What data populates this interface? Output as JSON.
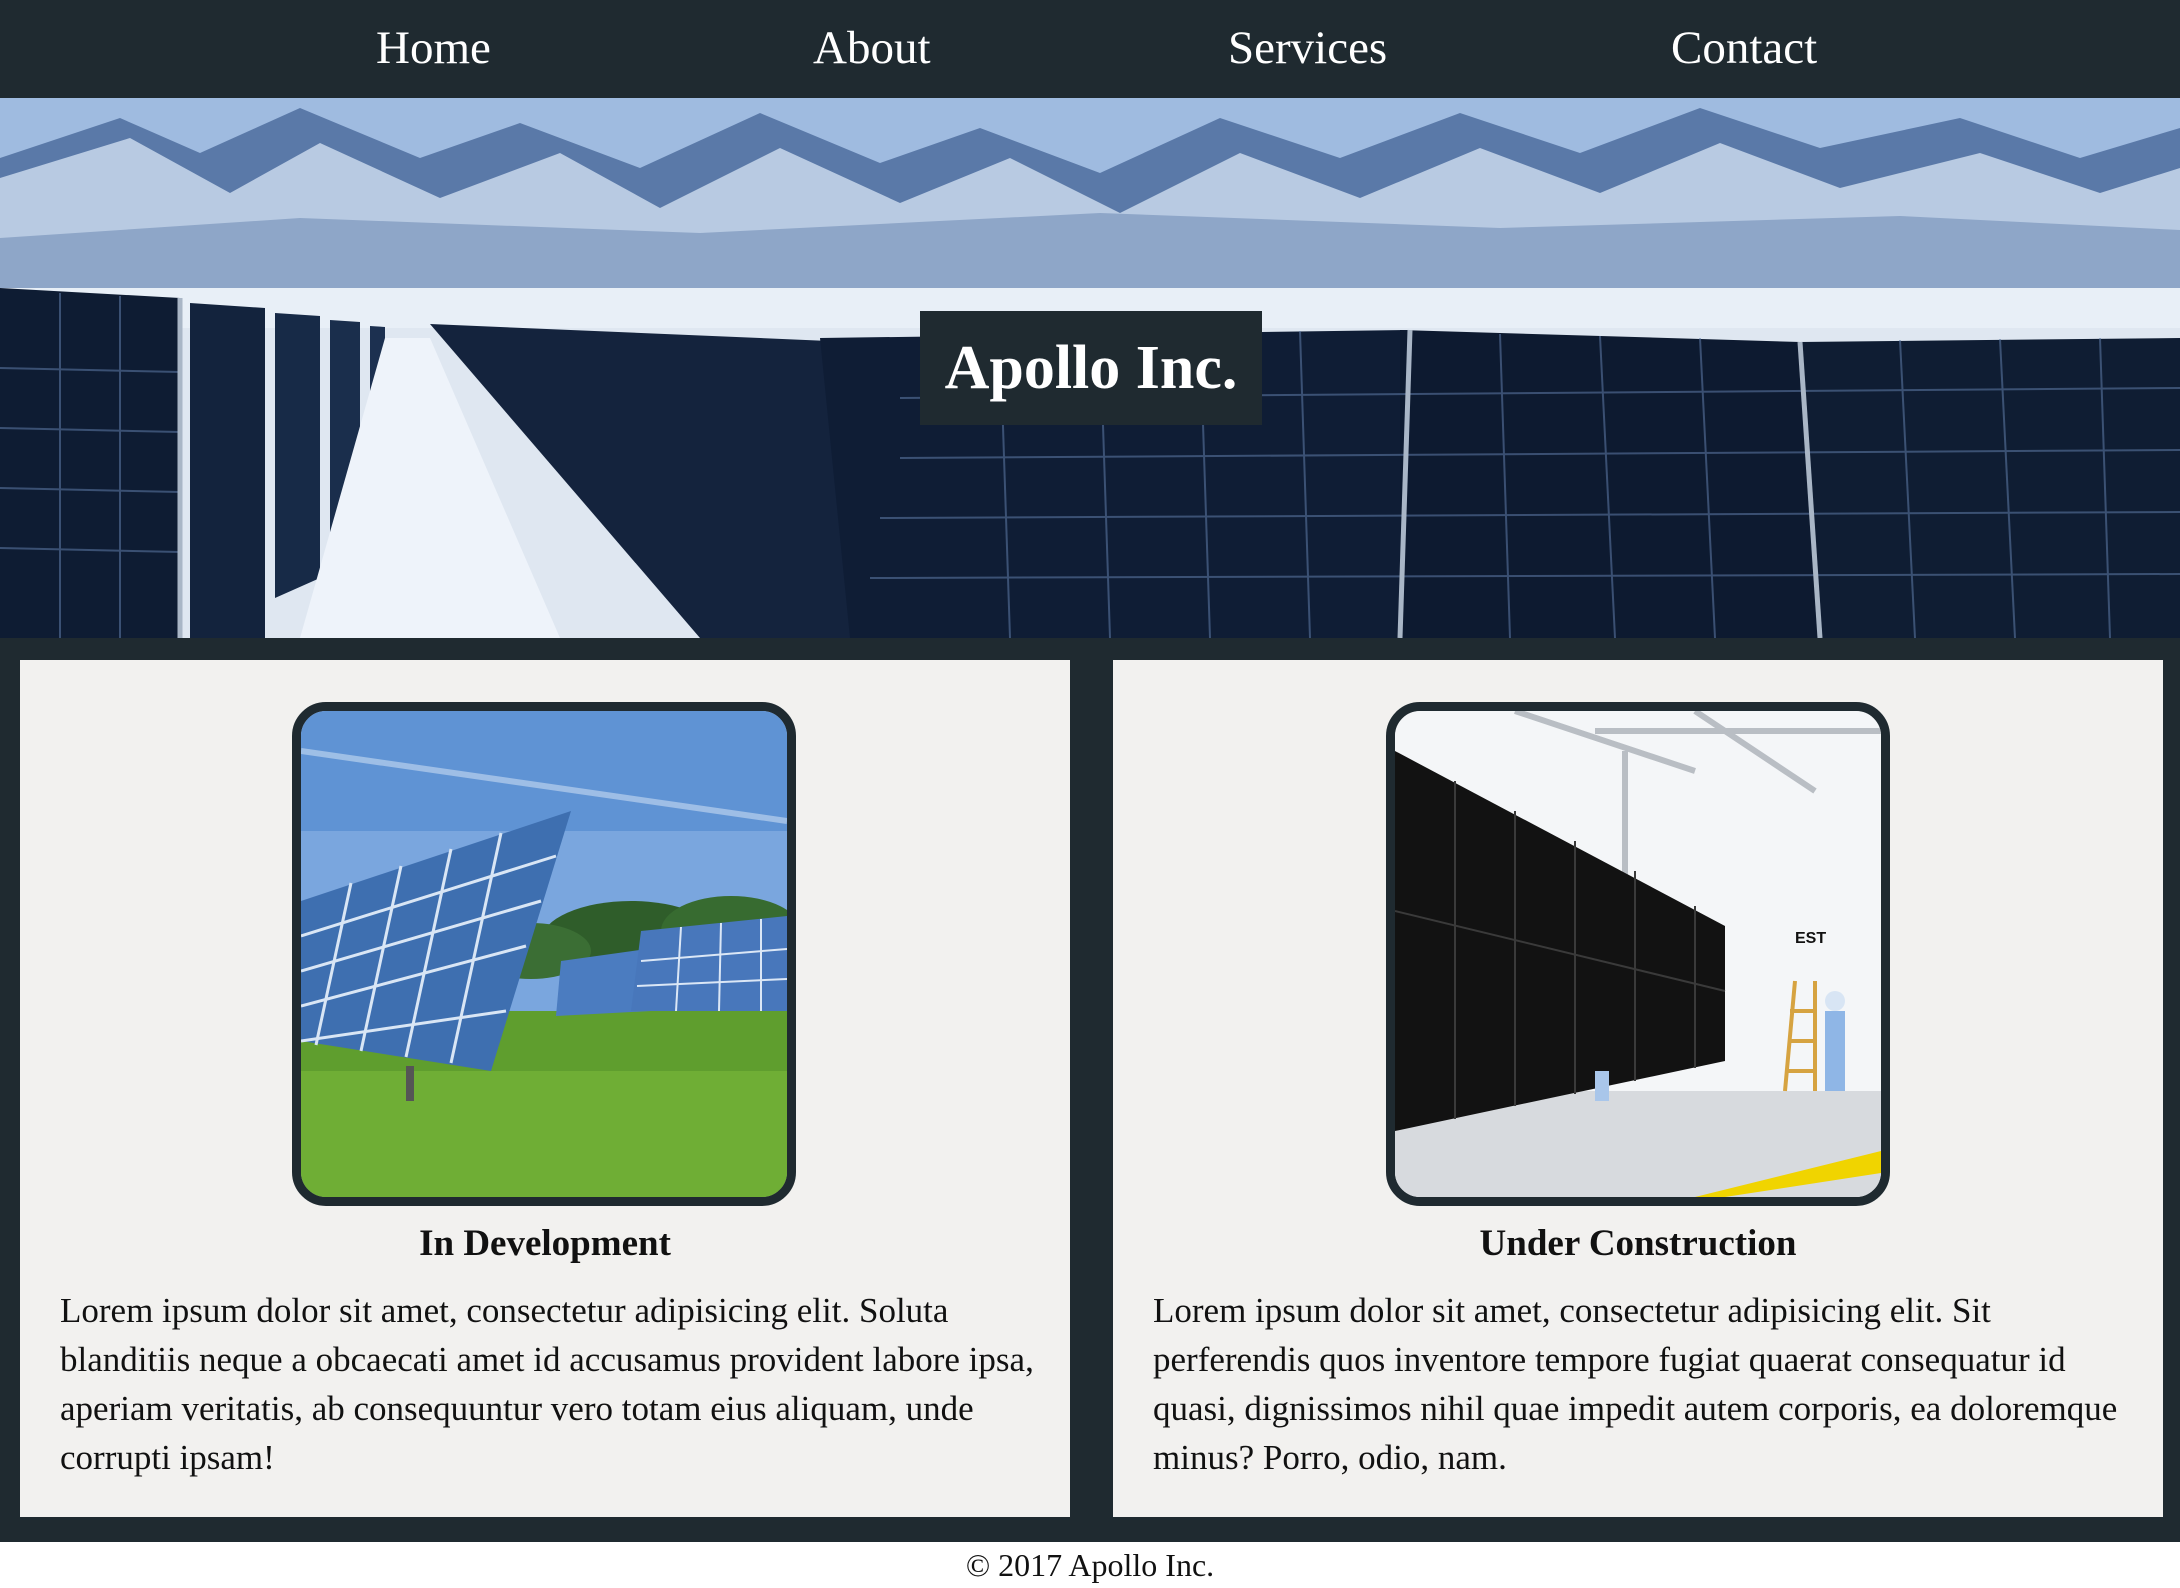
{
  "nav": {
    "items": [
      {
        "label": "Home"
      },
      {
        "label": "About"
      },
      {
        "label": "Services"
      },
      {
        "label": "Contact"
      }
    ]
  },
  "hero": {
    "title": "Apollo Inc."
  },
  "cards": [
    {
      "title": "In Development",
      "text": "Lorem ipsum dolor sit amet, consectetur adipisicing elit. Soluta blanditiis neque a obcaecati amet id accusamus provident labore ipsa, aperiam veritatis, ab consequuntur vero totam eius aliquam, unde corrupti ipsam!"
    },
    {
      "title": "Under Construction",
      "text": "Lorem ipsum dolor sit amet, consectetur adipisicing elit. Sit perferendis quos inventore tempore fugiat quaerat consequatur id quasi, dignissimos nihil quae impedit autem corporis, ea doloremque minus? Porro, odio, nam."
    }
  ],
  "footer": {
    "text": "© 2017 Apollo Inc."
  },
  "colors": {
    "dark": "#1f2a30",
    "card_bg": "#f2f1ef"
  }
}
